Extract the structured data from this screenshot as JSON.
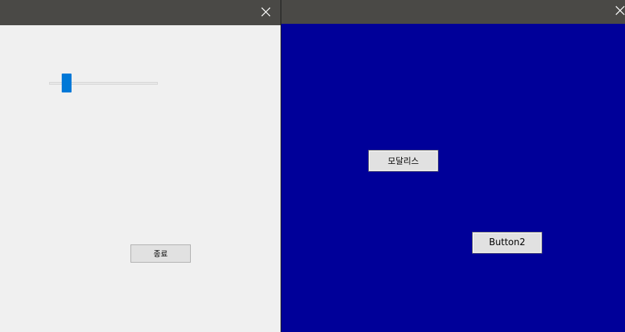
{
  "left_window": {
    "close_glyph": "✕",
    "slider": {
      "min": 0,
      "max": 100,
      "value": 13
    },
    "exit_button_label": "종료"
  },
  "right_window": {
    "close_glyph": "✕",
    "modeless_button_label": "모달리스",
    "button2_label": "Button2"
  },
  "colors": {
    "titlebar": "#4a4946",
    "left_client": "#f0f0f0",
    "right_client": "#000099",
    "slider_thumb": "#0078d7",
    "button_face": "#e1e1e1"
  }
}
